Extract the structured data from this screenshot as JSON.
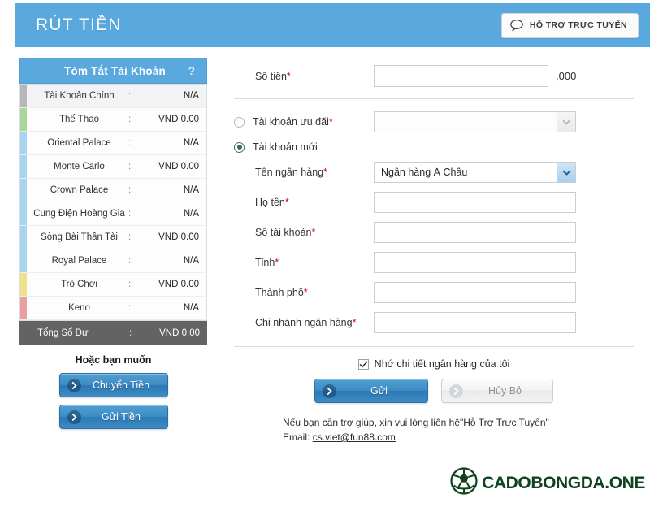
{
  "header": {
    "title": "RÚT TIỀN",
    "support_button": {
      "label": "HỖ TRỢ TRỰC TUYẾN",
      "icon": "chat-bubble-icon"
    },
    "bg_color": "#5aa9de"
  },
  "sidebar": {
    "panel_title": "Tóm Tắt Tài Khoản",
    "help_label": "?",
    "rows": [
      {
        "label": "Tài Khoản Chính",
        "separator": ":",
        "value": "N/A",
        "marker_color": "#b7b7b7"
      },
      {
        "label": "Thể Thao",
        "separator": ":",
        "value": "VND 0.00",
        "marker_color": "#a8d79a"
      },
      {
        "label": "Oriental Palace",
        "separator": ":",
        "value": "N/A",
        "marker_color": "#a9d4ee"
      },
      {
        "label": "Monte Carlo",
        "separator": ":",
        "value": "VND 0.00",
        "marker_color": "#a9d4ee"
      },
      {
        "label": "Crown Palace",
        "separator": ":",
        "value": "N/A",
        "marker_color": "#a9d4ee"
      },
      {
        "label": "Cung Điện Hoàng Gia",
        "separator": ":",
        "value": "N/A",
        "marker_color": "#a9d4ee"
      },
      {
        "label": "Sòng Bài Thần Tài",
        "separator": ":",
        "value": "VND 0.00",
        "marker_color": "#a9d4ee"
      },
      {
        "label": "Royal Palace",
        "separator": ":",
        "value": "N/A",
        "marker_color": "#a9d4ee"
      },
      {
        "label": "Trò Chơi",
        "separator": ":",
        "value": "VND 0.00",
        "marker_color": "#f2e08a"
      },
      {
        "label": "Keno",
        "separator": ":",
        "value": "N/A",
        "marker_color": "#e9a0a0"
      }
    ],
    "total": {
      "label": "Tổng Số Dư",
      "separator": ":",
      "value": "VND 0.00",
      "bg_color": "#636363"
    },
    "footer_title": "Hoặc bạn muốn",
    "transfer_button": "Chuyển Tiền",
    "deposit_button": "Gửi Tiền"
  },
  "form": {
    "amount": {
      "label": "Số tiền",
      "required": "*",
      "value": "",
      "suffix": ",000"
    },
    "bonus_account": {
      "label": "Tài khoản ưu đãi",
      "required": "*",
      "selected": false,
      "select_value": ""
    },
    "new_account": {
      "label": "Tài khoản mới",
      "selected": true
    },
    "bank_name": {
      "label": "Tên ngân hàng",
      "required": "*",
      "value": "Ngân hàng Á Châu"
    },
    "full_name": {
      "label": "Họ tên",
      "required": "*",
      "value": ""
    },
    "account_number": {
      "label": "Số tài khoản",
      "required": "*",
      "value": ""
    },
    "province": {
      "label": "Tỉnh",
      "required": "*",
      "value": ""
    },
    "city": {
      "label": "Thành phố",
      "required": "*",
      "value": ""
    },
    "bank_branch": {
      "label": "Chi nhánh ngân hàng",
      "required": "*",
      "value": ""
    },
    "remember_checkbox": {
      "label": "Nhớ chi tiết ngân hàng của tôi",
      "checked": true
    },
    "submit_button": "Gửi",
    "cancel_button": "Hủy Bỏ"
  },
  "footer": {
    "help_line_prefix": "Nếu bạn cần trợ giúp, xin vui lòng liên hệ\"",
    "help_link": "Hỗ Trợ Trực Tuyến",
    "help_line_suffix": "\"",
    "email_label": "Email:",
    "email": "cs.viet@fun88.com"
  },
  "watermark": {
    "text": "CADOBONGDA.ONE",
    "icon": "soccer-ball-icon",
    "color": "#10421f"
  }
}
